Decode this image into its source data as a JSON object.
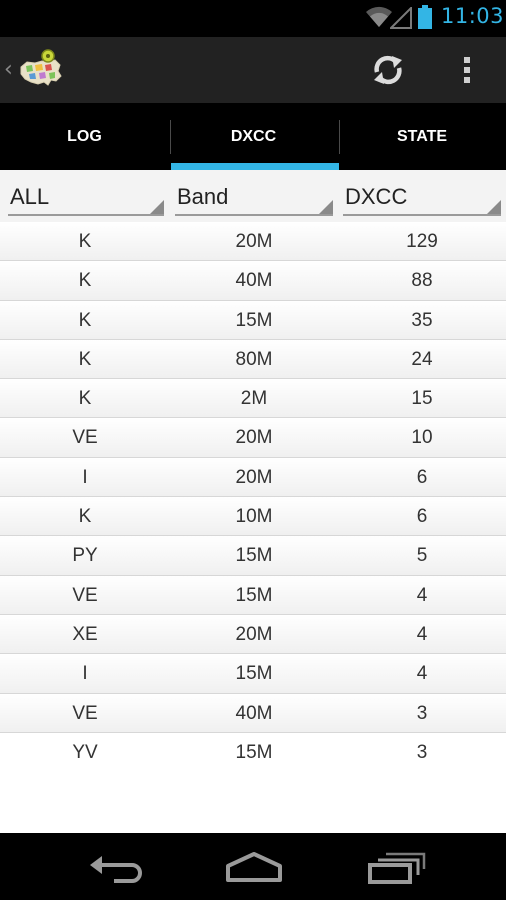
{
  "status_bar": {
    "time": "11:03",
    "icons": [
      "wifi-icon",
      "signal-icon",
      "battery-icon"
    ],
    "accent_color": "#33b5e5"
  },
  "action_bar": {
    "up_icon": "chevron-left-icon",
    "app_icon": "usa-map-app-icon",
    "actions": [
      "refresh-icon",
      "overflow-menu-icon"
    ]
  },
  "tabs": [
    {
      "label": "LOG",
      "selected": false
    },
    {
      "label": "DXCC",
      "selected": true
    },
    {
      "label": "STATE",
      "selected": false
    }
  ],
  "filters": {
    "prefix": "ALL",
    "band": "Band",
    "dxcc": "DXCC"
  },
  "table": {
    "rows": [
      {
        "prefix": "K",
        "band": "20M",
        "count": "129"
      },
      {
        "prefix": "K",
        "band": "40M",
        "count": "88"
      },
      {
        "prefix": "K",
        "band": "15M",
        "count": "35"
      },
      {
        "prefix": "K",
        "band": "80M",
        "count": "24"
      },
      {
        "prefix": "K",
        "band": "2M",
        "count": "15"
      },
      {
        "prefix": "VE",
        "band": "20M",
        "count": "10"
      },
      {
        "prefix": "I",
        "band": "20M",
        "count": "6"
      },
      {
        "prefix": "K",
        "band": "10M",
        "count": "6"
      },
      {
        "prefix": "PY",
        "band": "15M",
        "count": "5"
      },
      {
        "prefix": "VE",
        "band": "15M",
        "count": "4"
      },
      {
        "prefix": "XE",
        "band": "20M",
        "count": "4"
      },
      {
        "prefix": "I",
        "band": "15M",
        "count": "4"
      },
      {
        "prefix": "VE",
        "band": "40M",
        "count": "3"
      },
      {
        "prefix": "YV",
        "band": "15M",
        "count": "3"
      }
    ]
  },
  "nav_bar": {
    "buttons": [
      "back-icon",
      "home-icon",
      "recents-icon"
    ]
  }
}
